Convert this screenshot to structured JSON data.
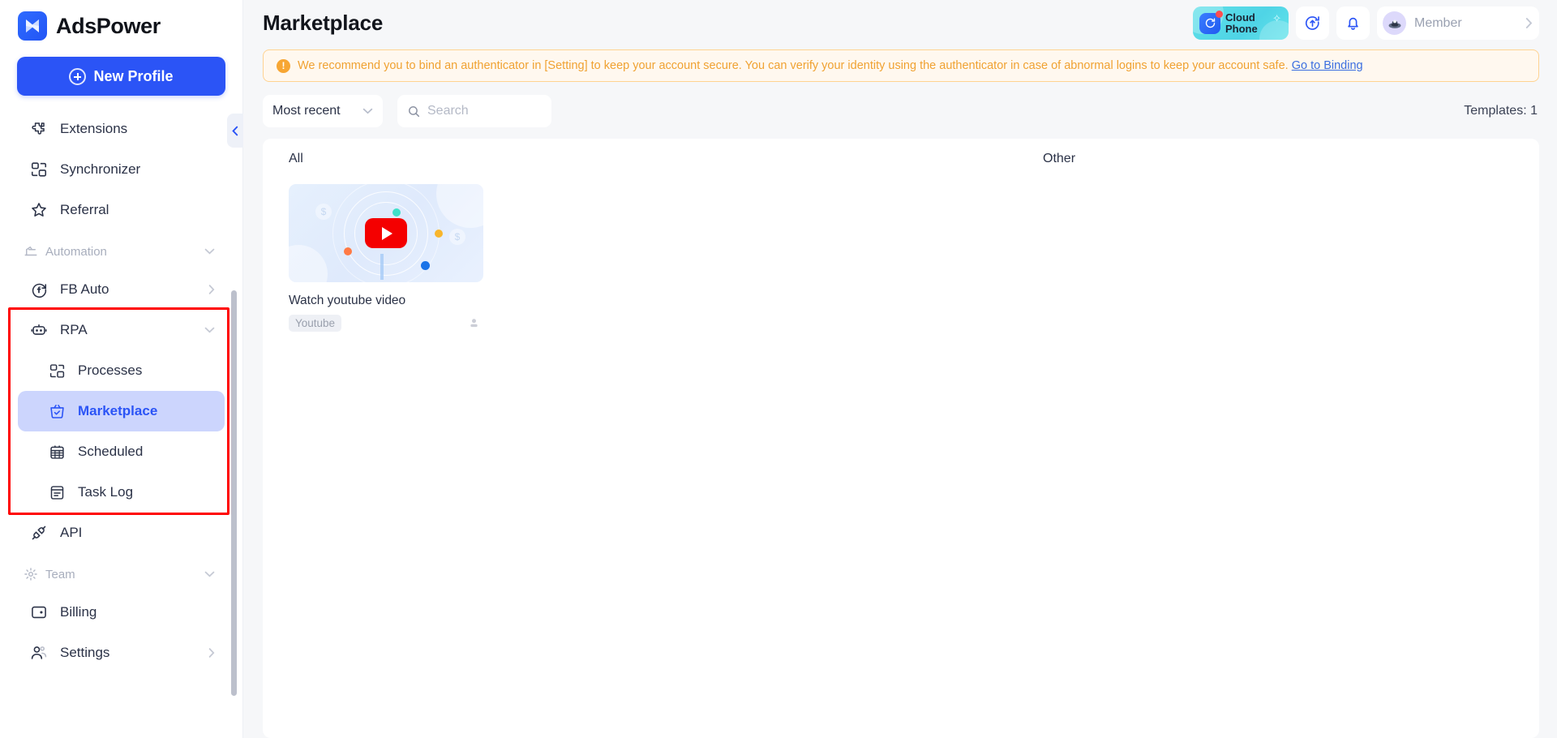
{
  "brand": {
    "name": "AdsPower",
    "logo_icon": "adspower-logo-icon"
  },
  "sidebar": {
    "new_profile_label": "New Profile",
    "items": [
      {
        "label": "Extensions",
        "icon": "puzzle-icon",
        "type": "item"
      },
      {
        "label": "Synchronizer",
        "icon": "sync-windows-icon",
        "type": "item"
      },
      {
        "label": "Referral",
        "icon": "star-icon",
        "type": "item"
      },
      {
        "label": "Automation",
        "icon": "automation-icon",
        "type": "section",
        "chevron": "chevron-down-icon"
      },
      {
        "label": "FB Auto",
        "icon": "facebook-auto-icon",
        "type": "item",
        "chevron": "chevron-right-icon"
      },
      {
        "label": "RPA",
        "icon": "robot-icon",
        "type": "item",
        "chevron": "chevron-down-icon"
      },
      {
        "label": "Processes",
        "icon": "processes-icon",
        "type": "sub"
      },
      {
        "label": "Marketplace",
        "icon": "marketplace-basket-icon",
        "type": "sub",
        "active": true
      },
      {
        "label": "Scheduled",
        "icon": "calendar-icon",
        "type": "sub"
      },
      {
        "label": "Task Log",
        "icon": "task-log-icon",
        "type": "sub"
      },
      {
        "label": "API",
        "icon": "api-icon",
        "type": "item"
      },
      {
        "label": "Team",
        "icon": "gear-icon",
        "type": "section",
        "chevron": "chevron-down-icon"
      },
      {
        "label": "Billing",
        "icon": "billing-wallet-icon",
        "type": "item"
      },
      {
        "label": "Settings",
        "icon": "people-icon",
        "type": "item",
        "chevron": "chevron-right-icon"
      }
    ],
    "collapse_icon": "chevron-left-icon",
    "highlight_color": "#ff0000"
  },
  "header": {
    "title": "Marketplace",
    "cloud_phone": {
      "line1": "Cloud",
      "line2": "Phone",
      "icon": "cloud-phone-icon"
    },
    "upload_icon": "upload-sync-icon",
    "notification_icon": "bell-icon",
    "user": {
      "name": "Member",
      "avatar_icon": "avatar-icon",
      "chevron": "chevron-right-icon"
    }
  },
  "banner": {
    "icon": "warning-icon",
    "text": "We recommend you to bind an authenticator in [Setting] to keep your account secure. You can verify your identity using the authenticator in case of abnormal logins to keep your account safe.",
    "link": "Go to Binding",
    "accent": "#f0a232",
    "background": "#fff8ef",
    "border": "#ffd391"
  },
  "toolbar": {
    "sort_value": "Most recent",
    "sort_chevron": "chevron-down-icon",
    "search_placeholder": "Search",
    "search_value": "",
    "search_icon": "search-icon",
    "templates_count_label": "Templates: 1"
  },
  "content": {
    "tabs": [
      {
        "label": "All"
      },
      {
        "label": "Other"
      }
    ],
    "cards": [
      {
        "title": "Watch youtube video",
        "tag": "Youtube",
        "thumb_icon": "youtube-play-icon",
        "users_icon": "person-icon",
        "users_count": ""
      }
    ]
  },
  "colors": {
    "primary": "#2b54f6",
    "active_bg": "#ccd5fd",
    "youtube_red": "#f40000",
    "page_bg": "#f6f7f9"
  }
}
